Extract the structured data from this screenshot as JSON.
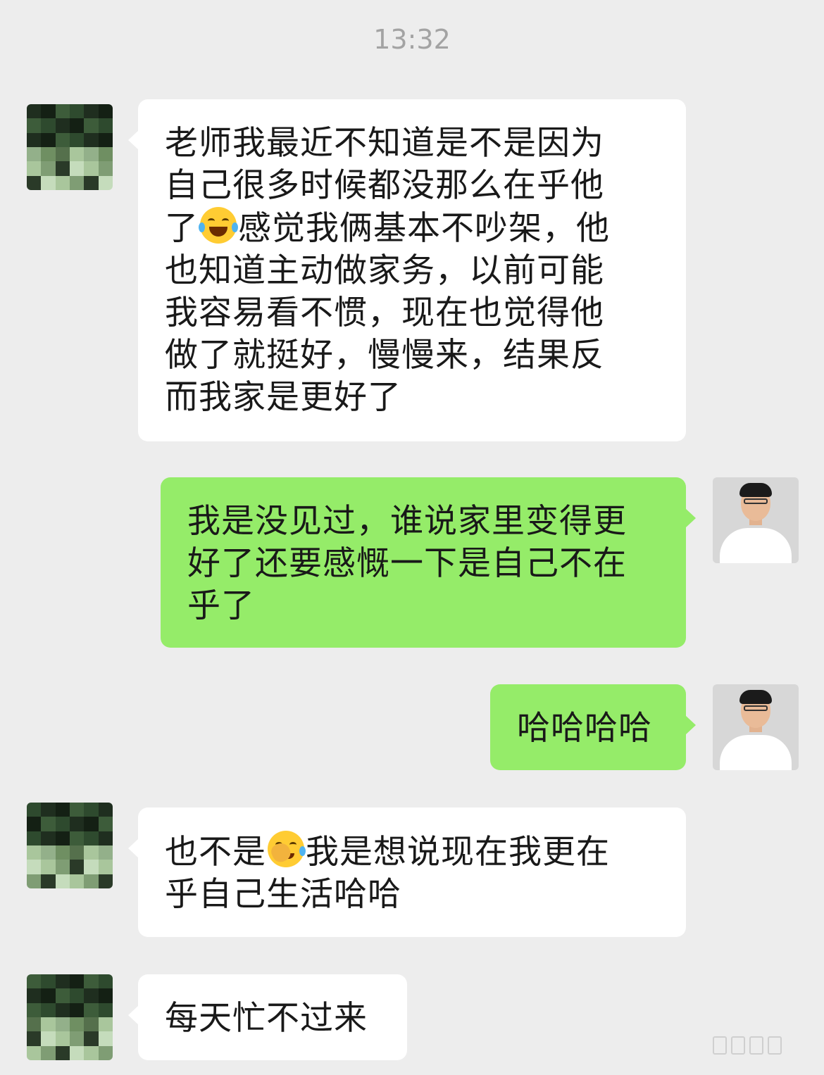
{
  "timestamp": "13:32",
  "messages": [
    {
      "side": "left",
      "lines": [
        [
          "老师我最近不知道是不是因为"
        ],
        [
          "自己很多时候都没那么在乎他"
        ],
        [
          "了",
          "😂",
          "感觉我俩基本不吵架，他"
        ],
        [
          "也知道主动做家务，以前可能"
        ],
        [
          "我容易看不惯，现在也觉得他"
        ],
        [
          "做了就挺好，慢慢来，结果反"
        ],
        [
          "而我家是更好了"
        ]
      ]
    },
    {
      "side": "right",
      "lines": [
        [
          "我是没见过，谁说家里变得更"
        ],
        [
          "好了还要感慨一下是自己不在"
        ],
        [
          "乎了"
        ]
      ]
    },
    {
      "side": "right",
      "lines": [
        [
          "哈哈哈哈"
        ]
      ]
    },
    {
      "side": "left",
      "lines": [
        [
          "也不是",
          "🤦",
          "我是想说现在我更在"
        ],
        [
          "乎自己生活哈哈"
        ]
      ]
    },
    {
      "side": "left",
      "lines": [
        [
          "每天忙不过来"
        ]
      ]
    }
  ],
  "emoji_names": {
    "😂": "face-with-tears-of-joy-emoji",
    "🤦": "facepalm-emoji"
  },
  "colors": {
    "background": "#ededed",
    "incoming_bubble": "#ffffff",
    "outgoing_bubble": "#95ec69",
    "timestamp_text": "#a3a3a3"
  }
}
